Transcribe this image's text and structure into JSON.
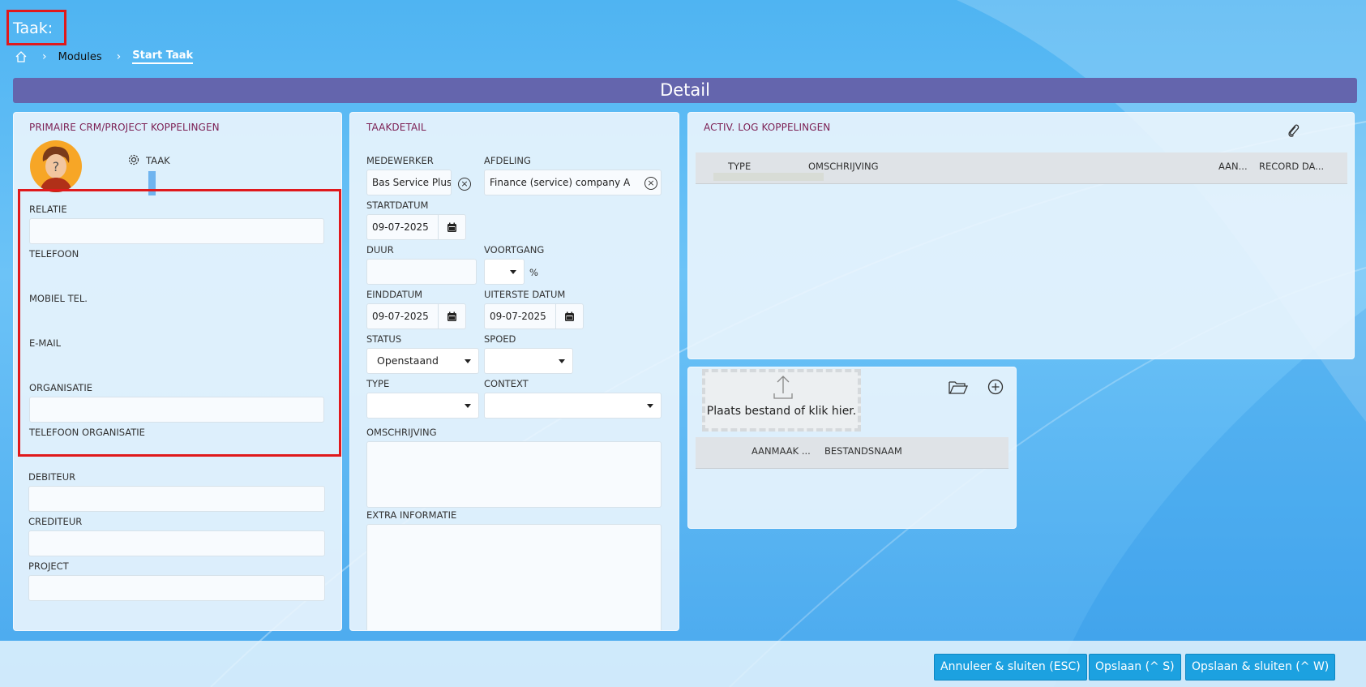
{
  "header": {
    "title": "Taak:",
    "breadcrumb": [
      "Modules",
      "Start Taak"
    ]
  },
  "banner": "Detail",
  "left_panel": {
    "title": "PRIMAIRE CRM/PROJECT KOPPELINGEN",
    "taak_label": "TAAK",
    "fields": {
      "relatie": "RELATIE",
      "telefoon": "TELEFOON",
      "mobiel": "MOBIEL TEL.",
      "email": "E-MAIL",
      "organisatie": "ORGANISATIE",
      "telefoon_org": "TELEFOON ORGANISATIE",
      "debiteur": "DEBITEUR",
      "crediteur": "CREDITEUR",
      "project": "PROJECT"
    }
  },
  "task_panel": {
    "title": "TAAKDETAIL",
    "medewerker_label": "MEDEWERKER",
    "medewerker_value": "Bas Service Plus",
    "afdeling_label": "AFDELING",
    "afdeling_value": "Finance (service) company A",
    "startdatum_label": "STARTDATUM",
    "startdatum_value": "09-07-2025",
    "duur_label": "DUUR",
    "voortgang_label": "VOORTGANG",
    "percent": "%",
    "einddatum_label": "EINDDATUM",
    "einddatum_value": "09-07-2025",
    "uiterste_label": "UITERSTE DATUM",
    "uiterste_value": "09-07-2025",
    "status_label": "STATUS",
    "status_value": "Openstaand",
    "spoed_label": "SPOED",
    "type_label": "TYPE",
    "context_label": "CONTEXT",
    "omschrijving_label": "OMSCHRIJVING",
    "extra_label": "EXTRA INFORMATIE"
  },
  "activity_panel": {
    "title": "ACTIV. LOG KOPPELINGEN",
    "columns": [
      "TYPE",
      "OMSCHRIJVING",
      "AAN...",
      "RECORD DA..."
    ]
  },
  "files_panel": {
    "dropzone_text": "Plaats bestand of klik hier.",
    "columns": [
      "AANMAAK ...",
      "BESTANDSNAAM"
    ]
  },
  "footer": {
    "cancel": "Annuleer & sluiten (ESC)",
    "save": "Opslaan (^ S)",
    "save_close": "Opslaan & sluiten (^ W)"
  },
  "colors": {
    "accent": "#1ca1e0",
    "banner": "#6465ad",
    "section_title": "#7c1f53",
    "highlight": "#e0191c"
  }
}
